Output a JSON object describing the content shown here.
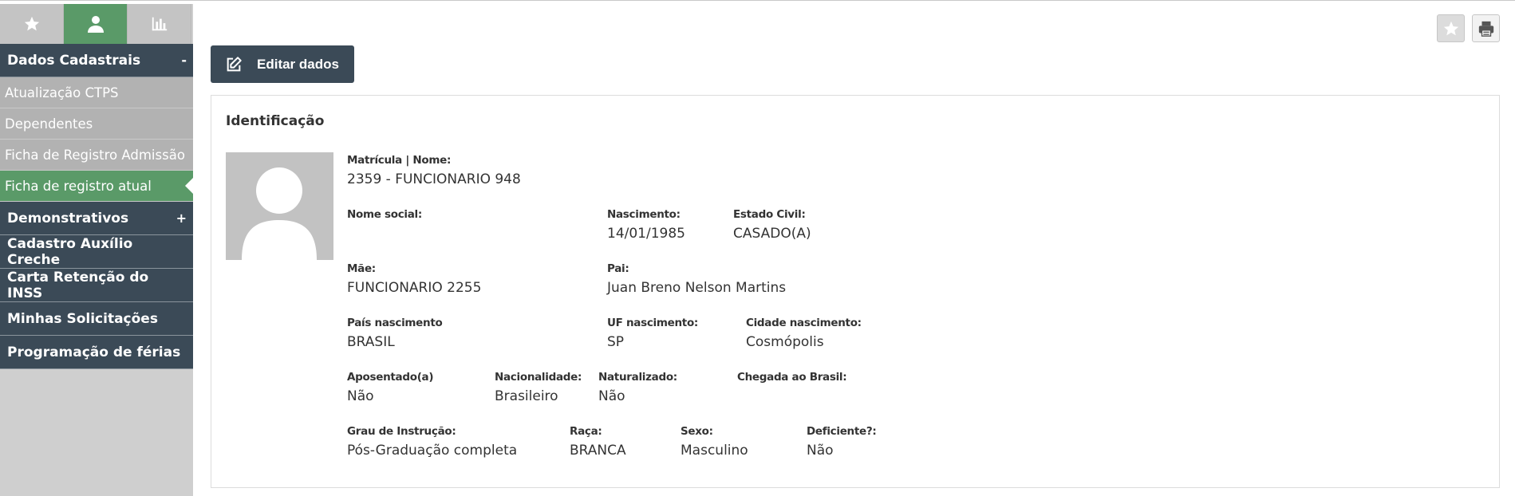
{
  "sidebar": {
    "tabs": [
      {
        "icon": "star-icon",
        "active": false
      },
      {
        "icon": "user-icon",
        "active": true
      },
      {
        "icon": "bar-chart-icon",
        "active": false
      }
    ],
    "group_dados": {
      "label": "Dados Cadastrais",
      "toggle": "-"
    },
    "sub_items": [
      {
        "label": "Atualização CTPS"
      },
      {
        "label": "Dependentes"
      },
      {
        "label": "Ficha de Registro Admissão"
      },
      {
        "label": "Ficha de registro atual"
      }
    ],
    "group_demonstrativos": {
      "label": "Demonstrativos",
      "toggle": "+"
    },
    "links": [
      {
        "label": "Cadastro Auxílio Creche"
      },
      {
        "label": "Carta Retenção do INSS"
      },
      {
        "label": "Minhas Solicitações"
      },
      {
        "label": "Programação de férias"
      }
    ]
  },
  "toolbar": {
    "edit_label": "Editar dados",
    "favorite_icon": "star-icon",
    "print_icon": "printer-icon"
  },
  "card": {
    "title": "Identificação",
    "fields": {
      "matricula": {
        "label": "Matrícula | Nome:",
        "value": "2359 - FUNCIONARIO 948"
      },
      "nome_social": {
        "label": "Nome social:",
        "value": ""
      },
      "nascimento": {
        "label": "Nascimento:",
        "value": "14/01/1985"
      },
      "estado_civil": {
        "label": "Estado Civil:",
        "value": "CASADO(A)"
      },
      "mae": {
        "label": "Mãe:",
        "value": "FUNCIONARIO 2255"
      },
      "pai": {
        "label": "Pai:",
        "value": "Juan Breno Nelson Martins"
      },
      "pais_nascimento": {
        "label": "País nascimento",
        "value": "BRASIL"
      },
      "uf_nascimento": {
        "label": "UF nascimento:",
        "value": "SP"
      },
      "cidade_nascimento": {
        "label": "Cidade nascimento:",
        "value": "Cosmópolis"
      },
      "aposentado": {
        "label": "Aposentado(a)",
        "value": "Não"
      },
      "nacionalidade": {
        "label": "Nacionalidade:",
        "value": "Brasileiro"
      },
      "naturalizado": {
        "label": "Naturalizado:",
        "value": "Não"
      },
      "chegada": {
        "label": "Chegada ao Brasil:",
        "value": ""
      },
      "grau_instrucao": {
        "label": "Grau de Instrução:",
        "value": "Pós-Graduação completa"
      },
      "raca": {
        "label": "Raça:",
        "value": "BRANCA"
      },
      "sexo": {
        "label": "Sexo:",
        "value": "Masculino"
      },
      "deficiente": {
        "label": "Deficiente?:",
        "value": "Não"
      }
    }
  },
  "colors": {
    "nav_dark": "#3b4a57",
    "accent_green": "#5a9a68",
    "sub_gray": "#b2b2b2"
  }
}
